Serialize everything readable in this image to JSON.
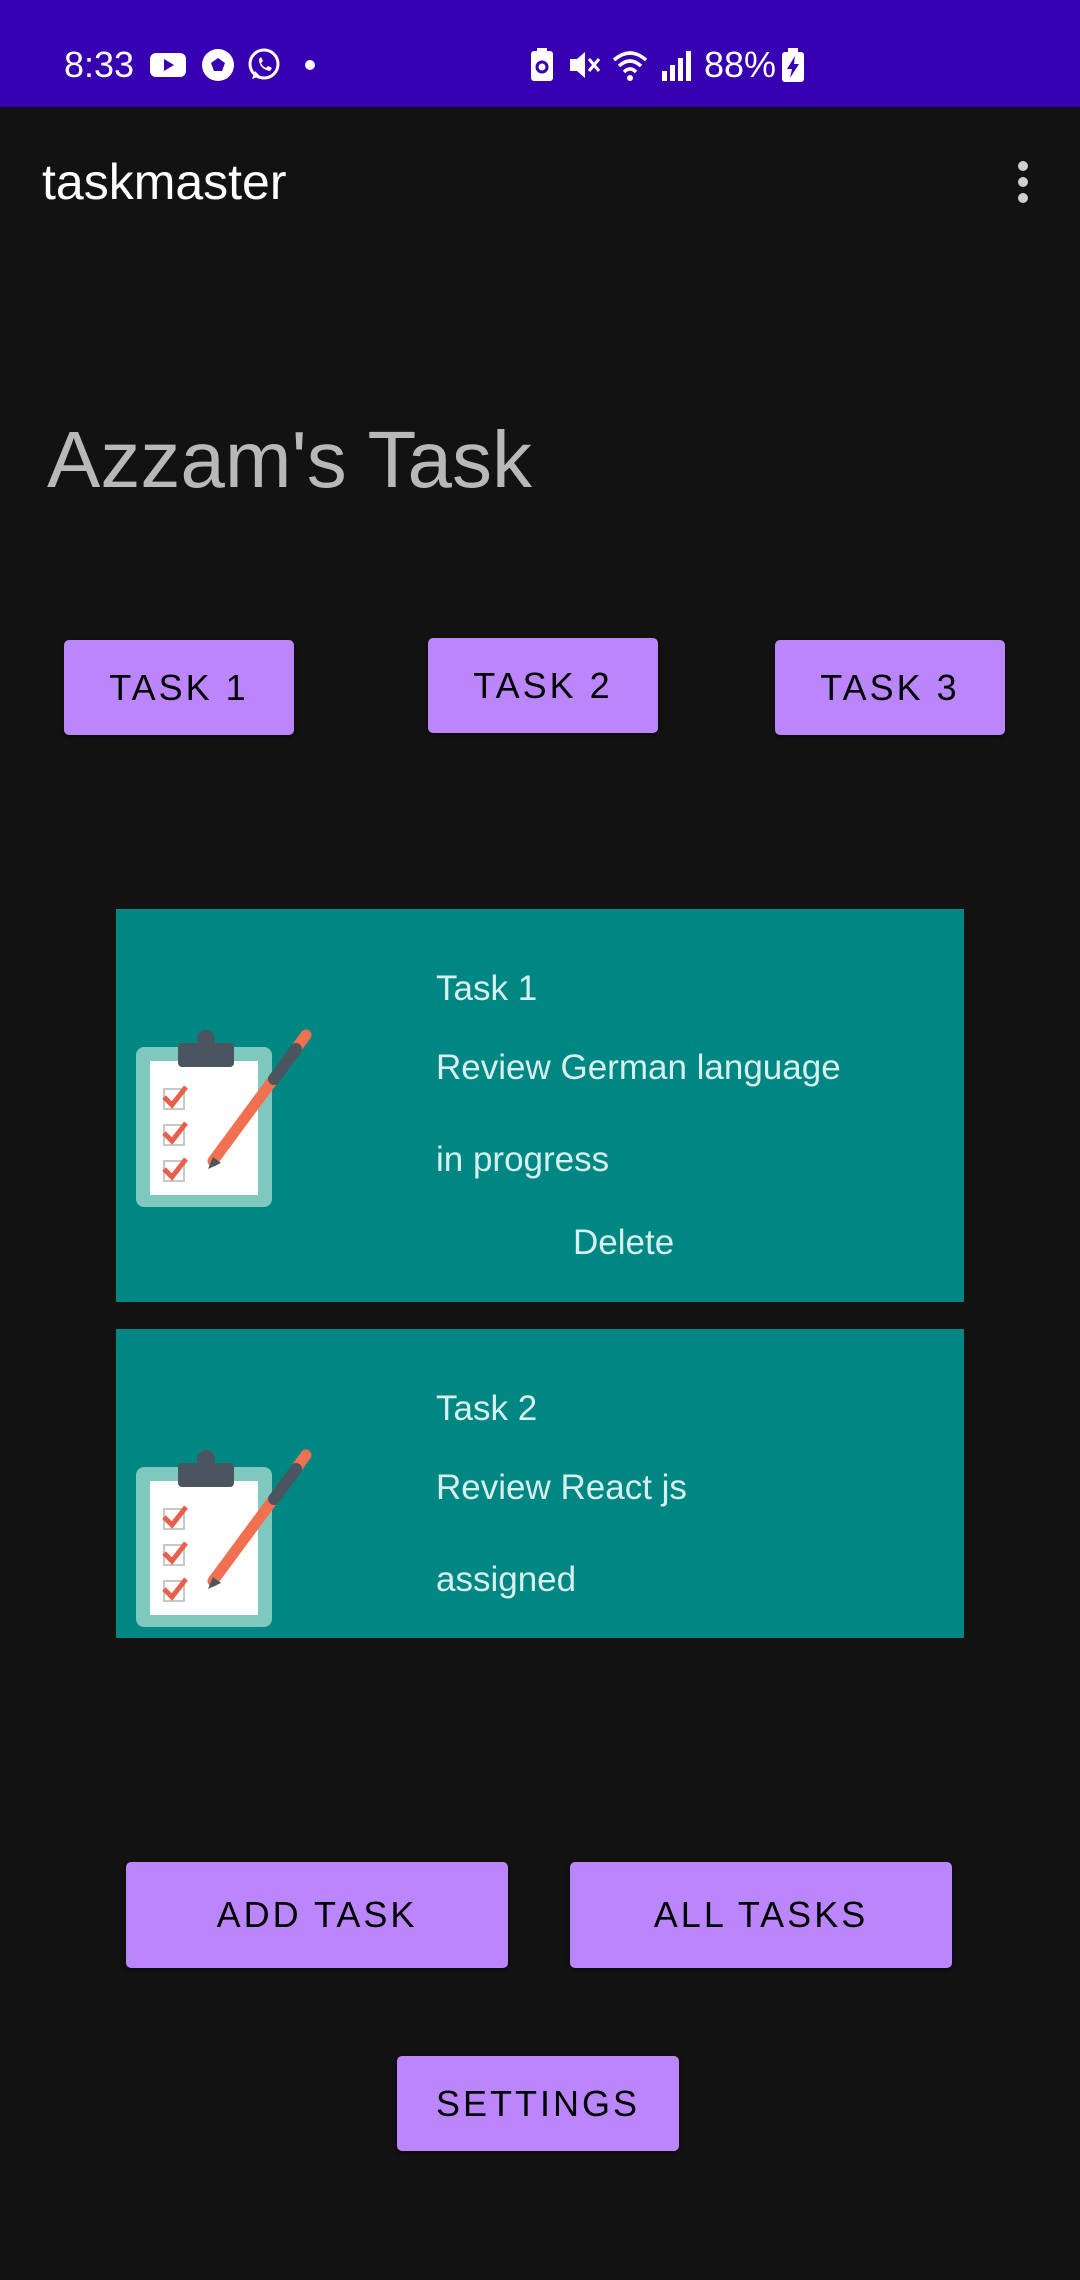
{
  "status_bar": {
    "time": "8:33",
    "battery": "88%",
    "left_icons": [
      "youtube-icon",
      "soccer-ball-icon",
      "whatsapp-icon",
      "dot-icon"
    ],
    "right_icons": [
      "battery-saver-icon",
      "mute-icon",
      "wifi-icon",
      "signal-icon",
      "battery-charging-icon"
    ],
    "background": "#3700b3"
  },
  "app_bar": {
    "title": "taskmaster",
    "menu_icon": "more-vert-icon"
  },
  "page": {
    "title": "Azzam's Task"
  },
  "task_buttons": [
    {
      "label": "TASK 1"
    },
    {
      "label": "TASK 2"
    },
    {
      "label": "TASK 3"
    }
  ],
  "tasks": [
    {
      "title": "Task 1",
      "body": "Review German language",
      "state": "in progress",
      "delete_label": "Delete",
      "icon": "clipboard-icon"
    },
    {
      "title": "Task 2",
      "body": "Review React js",
      "state": "assigned",
      "icon": "clipboard-icon"
    }
  ],
  "actions": {
    "add_task": "ADD TASK",
    "all_tasks": "ALL TASKS",
    "settings": "SETTINGS"
  },
  "colors": {
    "background": "#121212",
    "button": "#bb86fc",
    "card": "#008784"
  }
}
